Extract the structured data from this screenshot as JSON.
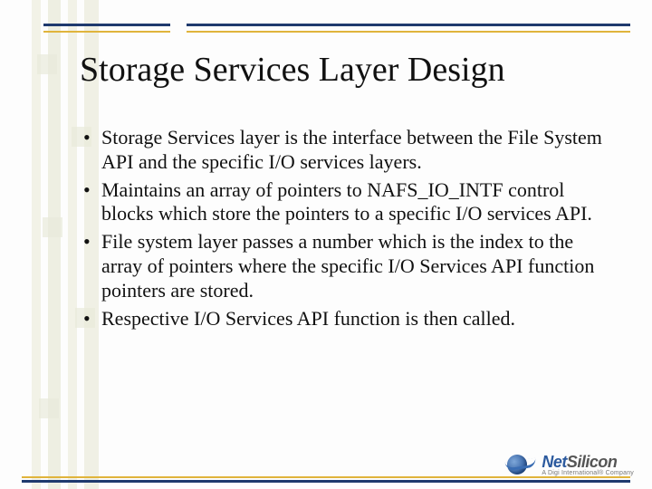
{
  "title": "Storage Services Layer Design",
  "bullets": [
    "Storage Services layer is the interface between the File System API and the specific I/O services layers.",
    "Maintains an array of pointers to NAFS_IO_INTF control blocks which store the pointers to a specific I/O services API.",
    "File system layer passes a number which is the index to the array of pointers where the specific I/O Services API function pointers are stored.",
    "Respective I/O Services API function is then called."
  ],
  "logo": {
    "brand_part1": "Net",
    "brand_part2": "Silicon",
    "tagline": "A Digi International® Company"
  }
}
